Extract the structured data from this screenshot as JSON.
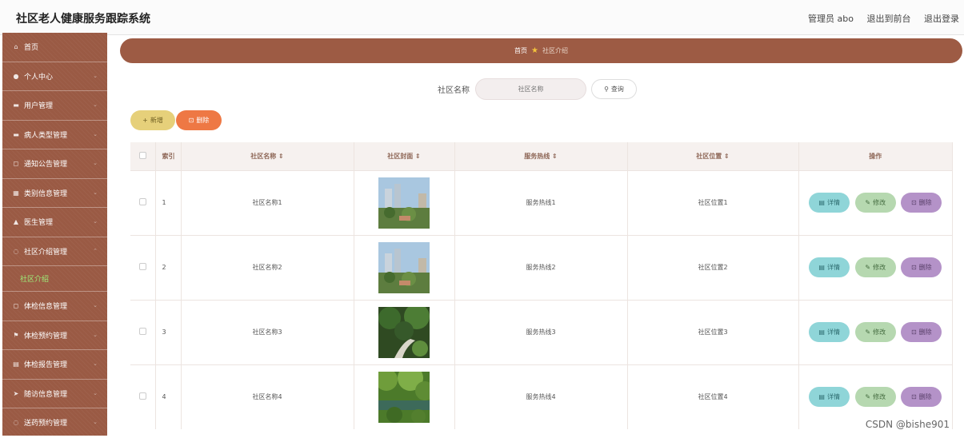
{
  "header": {
    "title": "社区老人健康服务跟踪系统",
    "user": "管理员 abo",
    "back_to_front": "退出到前台",
    "logout": "退出登录"
  },
  "sidebar": {
    "items": [
      {
        "label": "首页",
        "icon": "home-icon"
      },
      {
        "label": "个人中心",
        "icon": "user-icon"
      },
      {
        "label": "用户管理",
        "icon": "users-icon"
      },
      {
        "label": "病人类型管理",
        "icon": "list-icon"
      },
      {
        "label": "通知公告管理",
        "icon": "notice-icon"
      },
      {
        "label": "类别信息管理",
        "icon": "grid-icon"
      },
      {
        "label": "医生管理",
        "icon": "doctor-icon"
      },
      {
        "label": "社区介绍管理",
        "icon": "community-icon"
      },
      {
        "label": "体检信息管理",
        "icon": "exam-icon"
      },
      {
        "label": "体检预约管理",
        "icon": "flag-icon"
      },
      {
        "label": "体检报告管理",
        "icon": "report-icon"
      },
      {
        "label": "随访信息管理",
        "icon": "send-icon"
      },
      {
        "label": "送药预约管理",
        "icon": "medicine-icon"
      }
    ],
    "active_sub": "社区介绍"
  },
  "breadcrumb": {
    "home": "首页",
    "current": "社区介绍"
  },
  "search": {
    "label": "社区名称",
    "placeholder": "社区名称",
    "button": "查询"
  },
  "toolbar": {
    "add": "新增",
    "delete": "删除"
  },
  "table": {
    "columns": [
      "索引",
      "社区名称",
      "社区封面",
      "服务热线",
      "社区位置",
      "操作"
    ],
    "sort_mark": "⇕",
    "rows": [
      {
        "index": "1",
        "name": "社区名称1",
        "hotline": "服务热线1",
        "location": "社区位置1"
      },
      {
        "index": "2",
        "name": "社区名称2",
        "hotline": "服务热线2",
        "location": "社区位置2"
      },
      {
        "index": "3",
        "name": "社区名称3",
        "hotline": "服务热线3",
        "location": "社区位置3"
      },
      {
        "index": "4",
        "name": "社区名称4",
        "hotline": "服务热线4",
        "location": "社区位置4"
      }
    ],
    "actions": {
      "detail": "详情",
      "edit": "修改",
      "remove": "删除"
    }
  },
  "watermark": "CSDN @bishe901"
}
